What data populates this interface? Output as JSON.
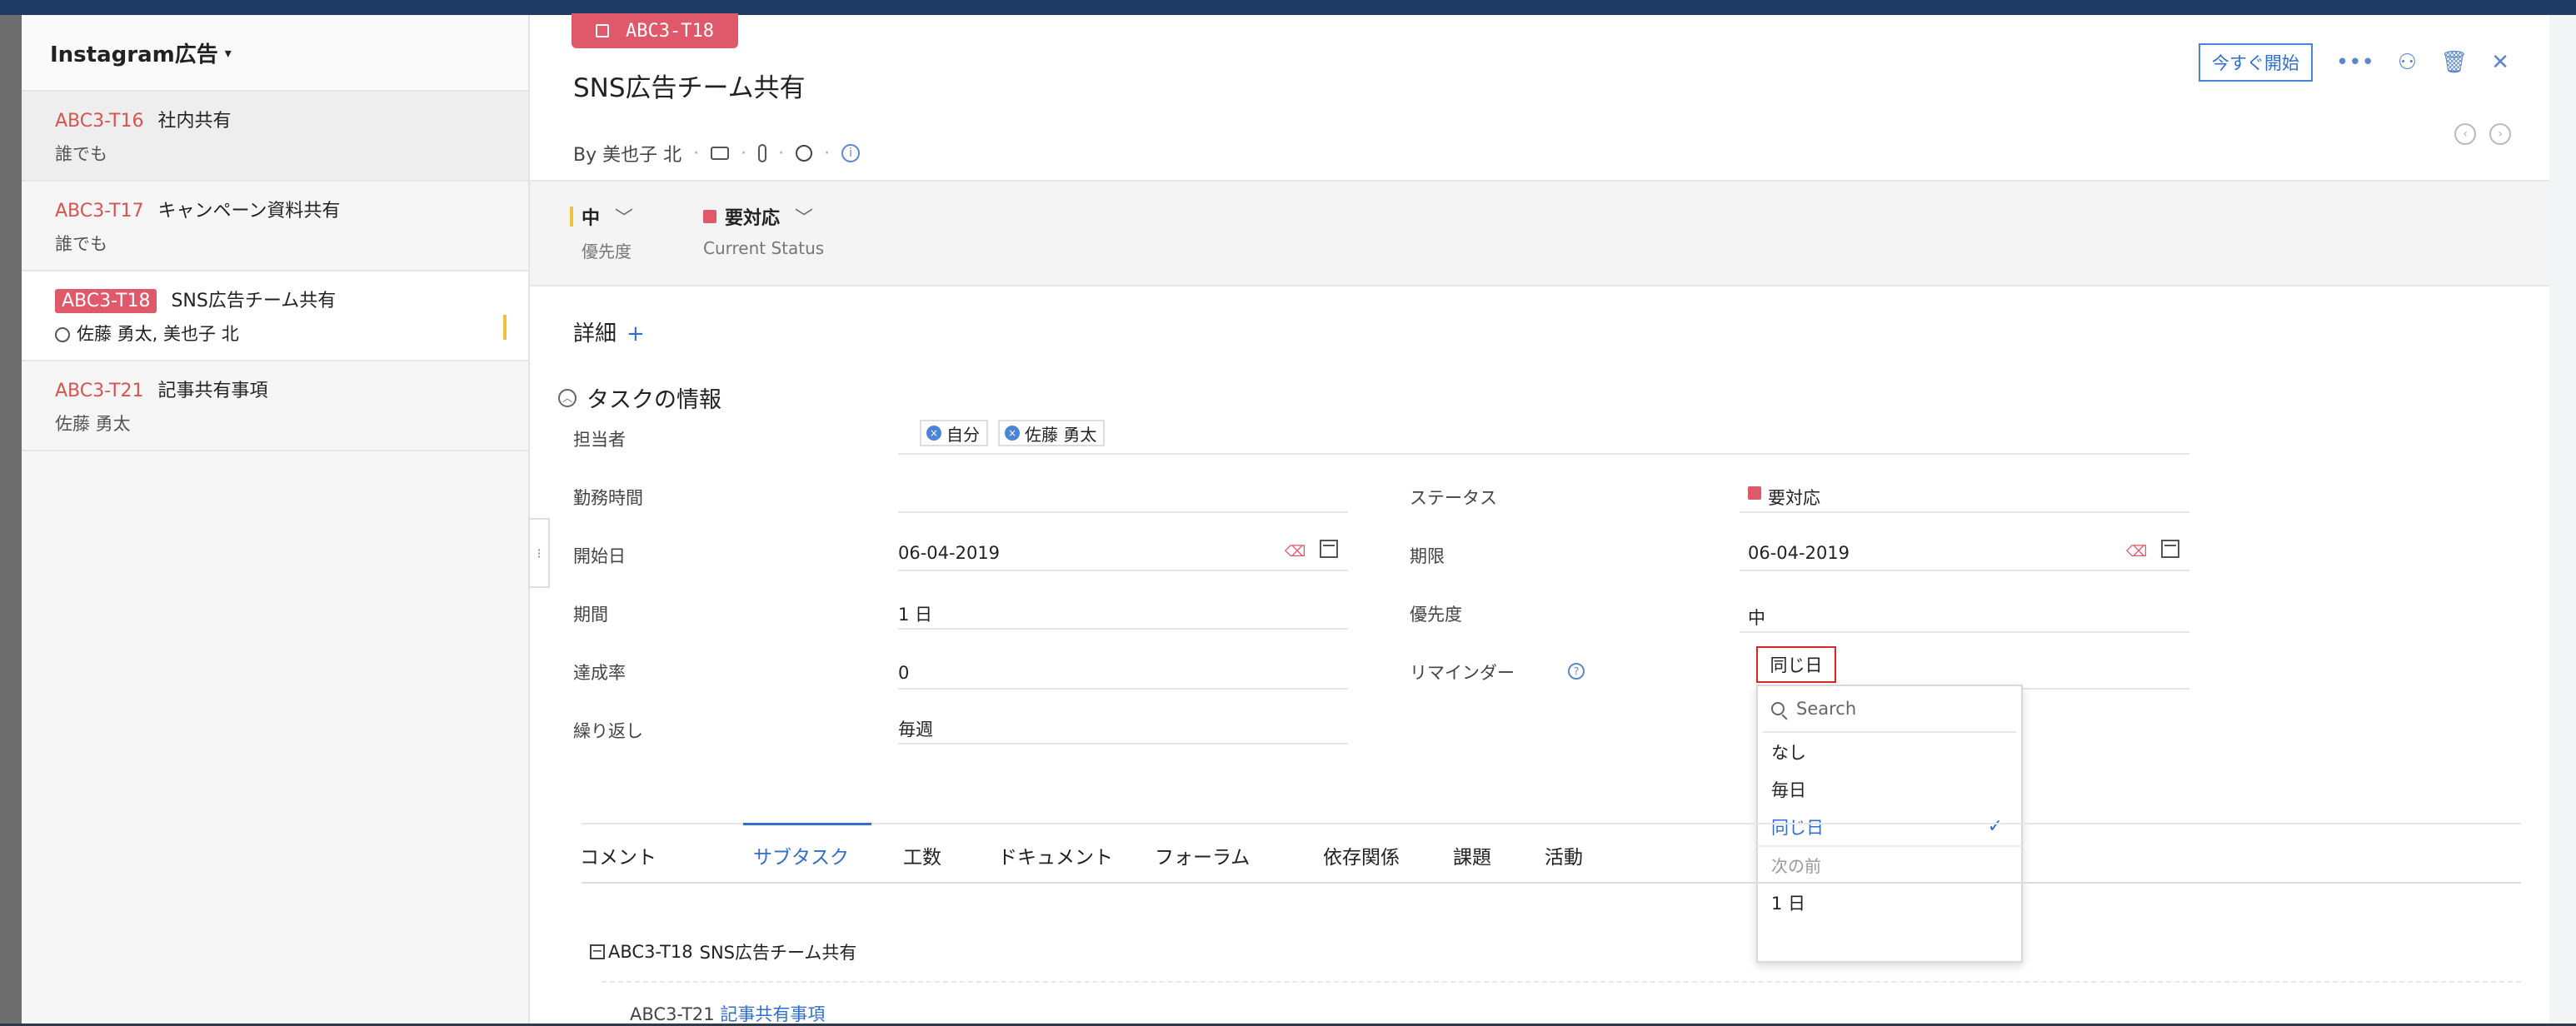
{
  "left_panel": {
    "title": "Instagram広告",
    "items": [
      {
        "id": "ABC3-T16",
        "title": "社内共有",
        "sub": "誰でも"
      },
      {
        "id": "ABC3-T17",
        "title": "キャンペーン資料共有",
        "sub": "誰でも"
      },
      {
        "id": "ABC3-T18",
        "title": "SNS広告チーム共有",
        "sub": "佐藤 勇太, 美也子 北"
      },
      {
        "id": "ABC3-T21",
        "title": "記事共有事項",
        "sub": "佐藤 勇太"
      }
    ]
  },
  "task": {
    "tag": "ABC3-T18",
    "title": "SNS広告チーム共有",
    "by": "By 美也子 北"
  },
  "actions": {
    "start_now": "今すぐ開始",
    "more": "•••"
  },
  "status_band": {
    "priority_value": "中",
    "priority_label": "優先度",
    "status_value": "要対応",
    "status_label": "Current Status"
  },
  "details": {
    "heading": "詳細",
    "plus": "+",
    "section": "タスクの情報",
    "assignee_label": "担当者",
    "assignees": [
      "自分",
      "佐藤 勇太"
    ],
    "work_hours_label": "勤務時間",
    "status_label": "ステータス",
    "status_value": "要対応",
    "start_label": "開始日",
    "start_value": "06-04-2019",
    "due_label": "期限",
    "due_value": "06-04-2019",
    "duration_label": "期間",
    "duration_value": "1 日",
    "priority_label": "優先度",
    "priority_value": "中",
    "progress_label": "達成率",
    "progress_value": "0",
    "reminder_label": "リマインダー",
    "reminder_value": "同じ日",
    "repeat_label": "繰り返し",
    "repeat_value": "毎週"
  },
  "reminder_dropdown": {
    "search_placeholder": "Search",
    "options": [
      "なし",
      "毎日",
      "同じ日"
    ],
    "selected": "同じ日",
    "group_label": "次の前",
    "group_options": [
      "1 日"
    ]
  },
  "tabs": [
    "コメント",
    "サブタスク",
    "工数",
    "ドキュメント",
    "フォーラム",
    "依存関係",
    "課題",
    "活動"
  ],
  "active_tab": "サブタスク",
  "subtasks": {
    "parent_id": "ABC3-T18",
    "parent_title": "SNS広告チーム共有",
    "child_id": "ABC3-T21",
    "child_title": "記事共有事項"
  },
  "colors": {
    "accent": "#2f6fc9",
    "tag_red": "#e0596a",
    "priority_yellow": "#f0c040"
  }
}
